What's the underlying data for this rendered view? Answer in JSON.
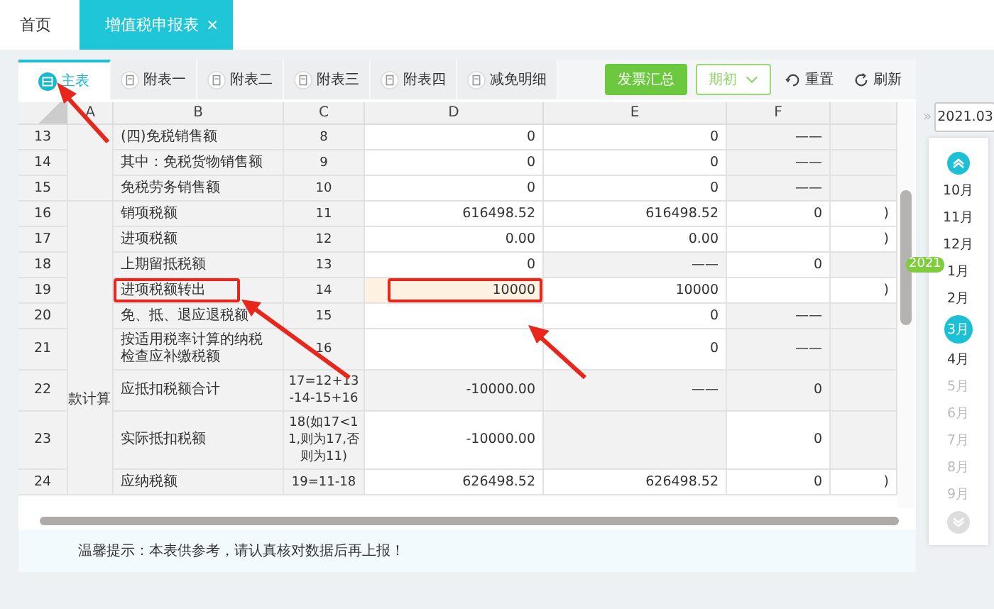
{
  "top_tabs": [
    {
      "label": "首页",
      "selected": false,
      "closable": false
    },
    {
      "label": "增值税申报表",
      "selected": true,
      "closable": true,
      "close": "×"
    }
  ],
  "sheet_tabs": [
    {
      "label": "主表",
      "selected": true
    },
    {
      "label": "附表一",
      "selected": false
    },
    {
      "label": "附表二",
      "selected": false
    },
    {
      "label": "附表三",
      "selected": false
    },
    {
      "label": "附表四",
      "selected": false
    },
    {
      "label": "减免明细",
      "selected": false
    }
  ],
  "toolbar": {
    "invoice_button": "发票汇总",
    "period_select": "期初",
    "reset": "重置",
    "refresh": "刷新"
  },
  "table": {
    "columns": [
      "A",
      "B",
      "C",
      "D",
      "E",
      "F",
      ""
    ],
    "sections": [
      {
        "rows": [
          {
            "num": "13",
            "b": {
              "text": "(四)免税销售额",
              "outlined": false
            },
            "c": "8",
            "d": {
              "text": "0",
              "editable": true,
              "selected": false,
              "outlined": false
            },
            "e": {
              "text": "0",
              "editable": true
            },
            "f": {
              "text": "——",
              "editable": false
            },
            "g": {
              "editable": false
            }
          },
          {
            "num": "14",
            "b": {
              "text": "其中：免税货物销售额",
              "outlined": false
            },
            "c": "9",
            "d": {
              "text": "0",
              "editable": true,
              "selected": false,
              "outlined": false
            },
            "e": {
              "text": "0",
              "editable": true
            },
            "f": {
              "text": "——",
              "editable": false
            },
            "g": {
              "editable": false
            }
          },
          {
            "num": "15",
            "b": {
              "text": "免税劳务销售额",
              "outlined": false
            },
            "c": "10",
            "d": {
              "text": "0",
              "editable": true,
              "selected": false,
              "outlined": false
            },
            "e": {
              "text": "0",
              "editable": true
            },
            "f": {
              "text": "——",
              "editable": false
            },
            "g": {
              "editable": false
            }
          }
        ]
      },
      {
        "label": "款计算",
        "rows": [
          {
            "num": "16",
            "b": {
              "text": "销项税额",
              "outlined": false
            },
            "c": "11",
            "d": {
              "text": "616498.52",
              "editable": true,
              "selected": false,
              "outlined": false
            },
            "e": {
              "text": "616498.52",
              "editable": true
            },
            "f": {
              "text": "0",
              "editable": true
            },
            "g": {
              "text": ")",
              "editable": true
            }
          },
          {
            "num": "17",
            "b": {
              "text": "进项税额",
              "outlined": false
            },
            "c": "12",
            "d": {
              "text": "0.00",
              "editable": true,
              "selected": false,
              "outlined": false
            },
            "e": {
              "text": "0.00",
              "editable": true
            },
            "f": {
              "editable": true
            },
            "g": {
              "text": ")",
              "editable": true
            }
          },
          {
            "num": "18",
            "b": {
              "text": "上期留抵税额",
              "outlined": false
            },
            "c": "13",
            "d": {
              "text": "0",
              "editable": true,
              "selected": false,
              "outlined": false
            },
            "e": {
              "text": "——",
              "editable": false
            },
            "f": {
              "text": "0",
              "editable": true
            },
            "g": {
              "editable": false
            }
          },
          {
            "num": "19",
            "b": {
              "text": "进项税额转出",
              "outlined": true
            },
            "c": "14",
            "d": {
              "text": "10000",
              "editable": true,
              "selected": true,
              "outlined": true
            },
            "e": {
              "text": "10000",
              "editable": true
            },
            "f": {
              "editable": true
            },
            "g": {
              "text": ")",
              "editable": true
            }
          },
          {
            "num": "20",
            "b": {
              "text": "免、抵、退应退税额",
              "outlined": false
            },
            "c": "15",
            "d": {
              "editable": true,
              "selected": false,
              "outlined": false
            },
            "e": {
              "text": "0",
              "editable": true
            },
            "f": {
              "text": "——",
              "editable": false
            },
            "g": {
              "editable": false
            }
          },
          {
            "num": "21",
            "b": {
              "text": "按适用税率计算的纳税检查应补缴税额",
              "outlined": false
            },
            "c": "16",
            "d": {
              "editable": true,
              "selected": false,
              "outlined": false
            },
            "e": {
              "text": "0",
              "editable": true
            },
            "f": {
              "text": "——",
              "editable": false
            },
            "g": {
              "editable": false
            }
          },
          {
            "num": "22",
            "b": {
              "text": "应抵扣税额合计",
              "outlined": false
            },
            "c": "17=12+13-14-15+16",
            "d": {
              "text": "-10000.00",
              "editable": false,
              "selected": false,
              "outlined": false
            },
            "e": {
              "text": "——",
              "editable": false
            },
            "f": {
              "text": "0",
              "editable": false
            },
            "g": {
              "editable": false
            }
          },
          {
            "num": "23",
            "b": {
              "text": "实际抵扣税额",
              "outlined": false
            },
            "c": "18(如17<11,则为17,否则为11)",
            "d": {
              "text": "-10000.00",
              "editable": true,
              "selected": false,
              "outlined": false
            },
            "e": {
              "editable": false
            },
            "f": {
              "text": "0",
              "editable": true
            },
            "g": {
              "editable": false
            }
          },
          {
            "num": "24",
            "b": {
              "text": "应纳税额",
              "outlined": false
            },
            "c": "19=11-18",
            "d": {
              "text": "626498.52",
              "editable": true,
              "selected": false,
              "outlined": false
            },
            "e": {
              "text": "626498.52",
              "editable": true
            },
            "f": {
              "text": "0",
              "editable": true
            },
            "g": {
              "text": ")",
              "editable": true
            }
          }
        ]
      }
    ]
  },
  "notice": "温馨提示：本表供参考，请认真核对数据后再上报！",
  "calendar": {
    "collapse": "»",
    "period": "2021.03",
    "year_badge": "2021",
    "months": [
      {
        "label": "10月",
        "selected": false,
        "disabled": false,
        "year_start": false
      },
      {
        "label": "11月",
        "selected": false,
        "disabled": false,
        "year_start": false
      },
      {
        "label": "12月",
        "selected": false,
        "disabled": false,
        "year_start": false
      },
      {
        "label": "1月",
        "selected": false,
        "disabled": false,
        "year_start": true
      },
      {
        "label": "2月",
        "selected": false,
        "disabled": false,
        "year_start": false
      },
      {
        "label": "3月",
        "selected": true,
        "disabled": false,
        "year_start": false
      },
      {
        "label": "4月",
        "selected": false,
        "disabled": false,
        "year_start": false
      },
      {
        "label": "5月",
        "selected": false,
        "disabled": true,
        "year_start": false
      },
      {
        "label": "6月",
        "selected": false,
        "disabled": true,
        "year_start": false
      },
      {
        "label": "7月",
        "selected": false,
        "disabled": true,
        "year_start": false
      },
      {
        "label": "8月",
        "selected": false,
        "disabled": true,
        "year_start": false
      },
      {
        "label": "9月",
        "selected": false,
        "disabled": true,
        "year_start": false
      }
    ]
  }
}
